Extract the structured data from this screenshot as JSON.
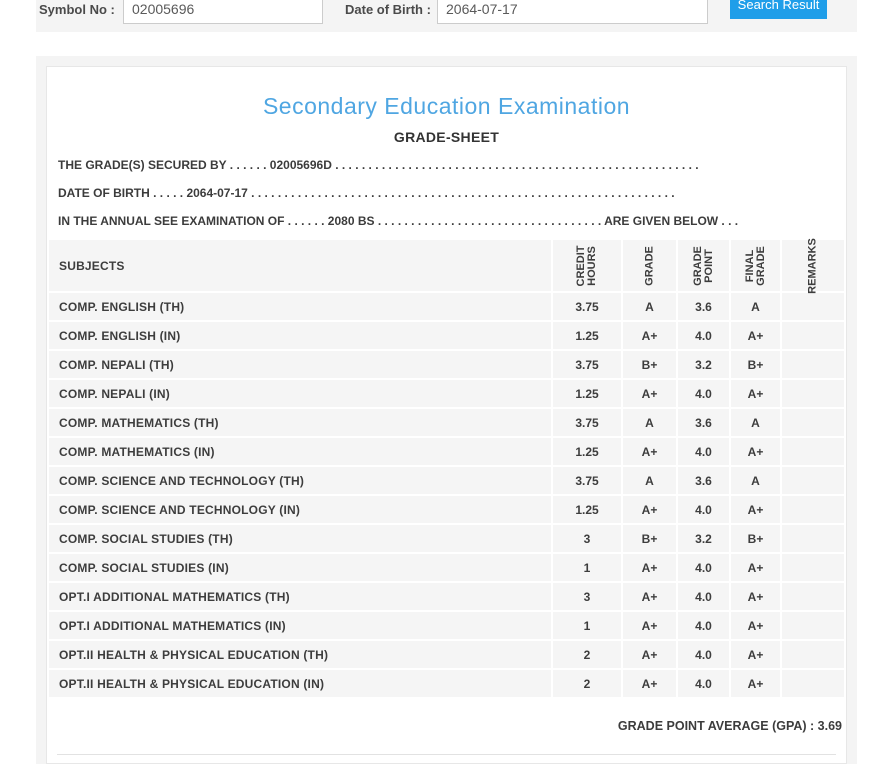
{
  "search_form": {
    "symbol_label": "Symbol No :",
    "symbol_value": "02005696",
    "dob_label": "Date of Birth :",
    "dob_value": "2064-07-17",
    "button_label": "Search Result"
  },
  "header": {
    "title": "Secondary Education Examination",
    "subtitle": "GRADE-SHEET"
  },
  "info_lines": [
    {
      "segments": [
        {
          "text": "THE GRADE(S) SECURED BY"
        },
        {
          "dots": 6
        },
        {
          "text": "02005696D"
        },
        {
          "dots": 55
        }
      ]
    },
    {
      "segments": [
        {
          "text": "DATE OF BIRTH"
        },
        {
          "dots": 5
        },
        {
          "text": "2064-07-17"
        },
        {
          "dots": 64
        }
      ]
    },
    {
      "segments": [
        {
          "text": "IN THE ANNUAL SEE EXAMINATION OF"
        },
        {
          "dots": 6
        },
        {
          "text": "2080 BS"
        },
        {
          "dots": 34
        },
        {
          "text": "ARE GIVEN BELOW"
        },
        {
          "dots": 3
        }
      ]
    }
  ],
  "table": {
    "subjects_header": "SUBJECTS",
    "vertical_headers": [
      [
        "CREDIT",
        "HOURS"
      ],
      [
        "GRADE"
      ],
      [
        "GRADE",
        "POINT"
      ],
      [
        "FINAL",
        "GRADE"
      ],
      [
        "REMARKS"
      ]
    ],
    "rows": [
      {
        "subject": "COMP. ENGLISH (TH)",
        "credit_hours": "3.75",
        "grade": "A",
        "grade_point": "3.6",
        "final_grade": "A",
        "remarks": ""
      },
      {
        "subject": "COMP. ENGLISH (IN)",
        "credit_hours": "1.25",
        "grade": "A+",
        "grade_point": "4.0",
        "final_grade": "A+",
        "remarks": ""
      },
      {
        "subject": "COMP. NEPALI (TH)",
        "credit_hours": "3.75",
        "grade": "B+",
        "grade_point": "3.2",
        "final_grade": "B+",
        "remarks": ""
      },
      {
        "subject": "COMP. NEPALI (IN)",
        "credit_hours": "1.25",
        "grade": "A+",
        "grade_point": "4.0",
        "final_grade": "A+",
        "remarks": ""
      },
      {
        "subject": "COMP. MATHEMATICS (TH)",
        "credit_hours": "3.75",
        "grade": "A",
        "grade_point": "3.6",
        "final_grade": "A",
        "remarks": ""
      },
      {
        "subject": "COMP. MATHEMATICS (IN)",
        "credit_hours": "1.25",
        "grade": "A+",
        "grade_point": "4.0",
        "final_grade": "A+",
        "remarks": ""
      },
      {
        "subject": "COMP. SCIENCE AND TECHNOLOGY (TH)",
        "credit_hours": "3.75",
        "grade": "A",
        "grade_point": "3.6",
        "final_grade": "A",
        "remarks": ""
      },
      {
        "subject": "COMP. SCIENCE AND TECHNOLOGY (IN)",
        "credit_hours": "1.25",
        "grade": "A+",
        "grade_point": "4.0",
        "final_grade": "A+",
        "remarks": ""
      },
      {
        "subject": "COMP. SOCIAL STUDIES (TH)",
        "credit_hours": "3",
        "grade": "B+",
        "grade_point": "3.2",
        "final_grade": "B+",
        "remarks": ""
      },
      {
        "subject": "COMP. SOCIAL STUDIES (IN)",
        "credit_hours": "1",
        "grade": "A+",
        "grade_point": "4.0",
        "final_grade": "A+",
        "remarks": ""
      },
      {
        "subject": "OPT.I ADDITIONAL MATHEMATICS (TH)",
        "credit_hours": "3",
        "grade": "A+",
        "grade_point": "4.0",
        "final_grade": "A+",
        "remarks": ""
      },
      {
        "subject": "OPT.I ADDITIONAL MATHEMATICS (IN)",
        "credit_hours": "1",
        "grade": "A+",
        "grade_point": "4.0",
        "final_grade": "A+",
        "remarks": ""
      },
      {
        "subject": "OPT.II HEALTH & PHYSICAL EDUCATION (TH)",
        "credit_hours": "2",
        "grade": "A+",
        "grade_point": "4.0",
        "final_grade": "A+",
        "remarks": ""
      },
      {
        "subject": "OPT.II HEALTH & PHYSICAL EDUCATION (IN)",
        "credit_hours": "2",
        "grade": "A+",
        "grade_point": "4.0",
        "final_grade": "A+",
        "remarks": ""
      }
    ]
  },
  "summary": {
    "gpa_line": "GRADE POINT AVERAGE (GPA) : 3.69"
  },
  "colors": {
    "accent_blue": "#4fa6e2",
    "button_blue": "#1f9ee9"
  }
}
